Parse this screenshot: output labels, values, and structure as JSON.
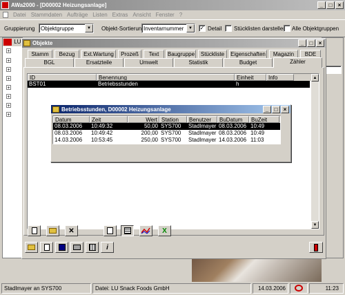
{
  "app": {
    "title": "AWa2000 - [D00002 Heizungsanlage]",
    "menu": [
      "Datei",
      "Stammdaten",
      "Aufträge",
      "Listen",
      "Extras",
      "Ansicht",
      "Fenster",
      "?"
    ]
  },
  "toolbar": {
    "gruppierung_label": "Gruppierung",
    "gruppierung_value": "Objektgruppe",
    "sortierung_label": "Objekt-Sortierung",
    "sortierung_value": "Inventarnummer",
    "detail_label": "Detail",
    "detail_checked": "✓",
    "stuecklisten_label": "Stücklisten darstellen",
    "alle_label": "Alle Objektgruppen"
  },
  "objekte": {
    "title": "Objekte",
    "tabs_row1": [
      "Stamm",
      "Bezug",
      "Ext.Wartung",
      "Prozeß",
      "Text",
      "Baugruppe",
      "Stückliste",
      "Eigenschaften",
      "Magazin",
      "BDE"
    ],
    "tabs_row2": [
      "BGL",
      "Ersatzteile",
      "Umwelt",
      "Statistik",
      "Budget",
      "Zähler"
    ],
    "columns": [
      "ID",
      "Benennung",
      "Einheit",
      "Info"
    ],
    "rows": [
      [
        "BST01",
        "Betriebsstunden",
        "h",
        ""
      ]
    ]
  },
  "betrieb": {
    "title": "Betriebsstunden, D00002 Heizungsanlage",
    "columns": [
      "Datum",
      "Zeit",
      "Wert",
      "Station",
      "Benutzer",
      "BuDatum",
      "BuZeit"
    ],
    "rows": [
      [
        "08.03.2006",
        "10:49:32",
        "50,00",
        "SYS700",
        "Stadlmayer",
        "08.03.2006",
        "10:49"
      ],
      [
        "08.03.2006",
        "10:49:42",
        "200,00",
        "SYS700",
        "Stadlmayer",
        "08.03.2006",
        "10:49"
      ],
      [
        "14.03.2006",
        "10:53:45",
        "250,00",
        "SYS700",
        "Stadlmayer",
        "14.03.2006",
        "11:03"
      ]
    ]
  },
  "left_panel": {
    "label": "LU"
  },
  "status": {
    "user": "Stadlmayer an SYS700",
    "file": "Datei: LU Snack Foods GmbH",
    "date": "14.03.2006",
    "time": "11:23"
  }
}
